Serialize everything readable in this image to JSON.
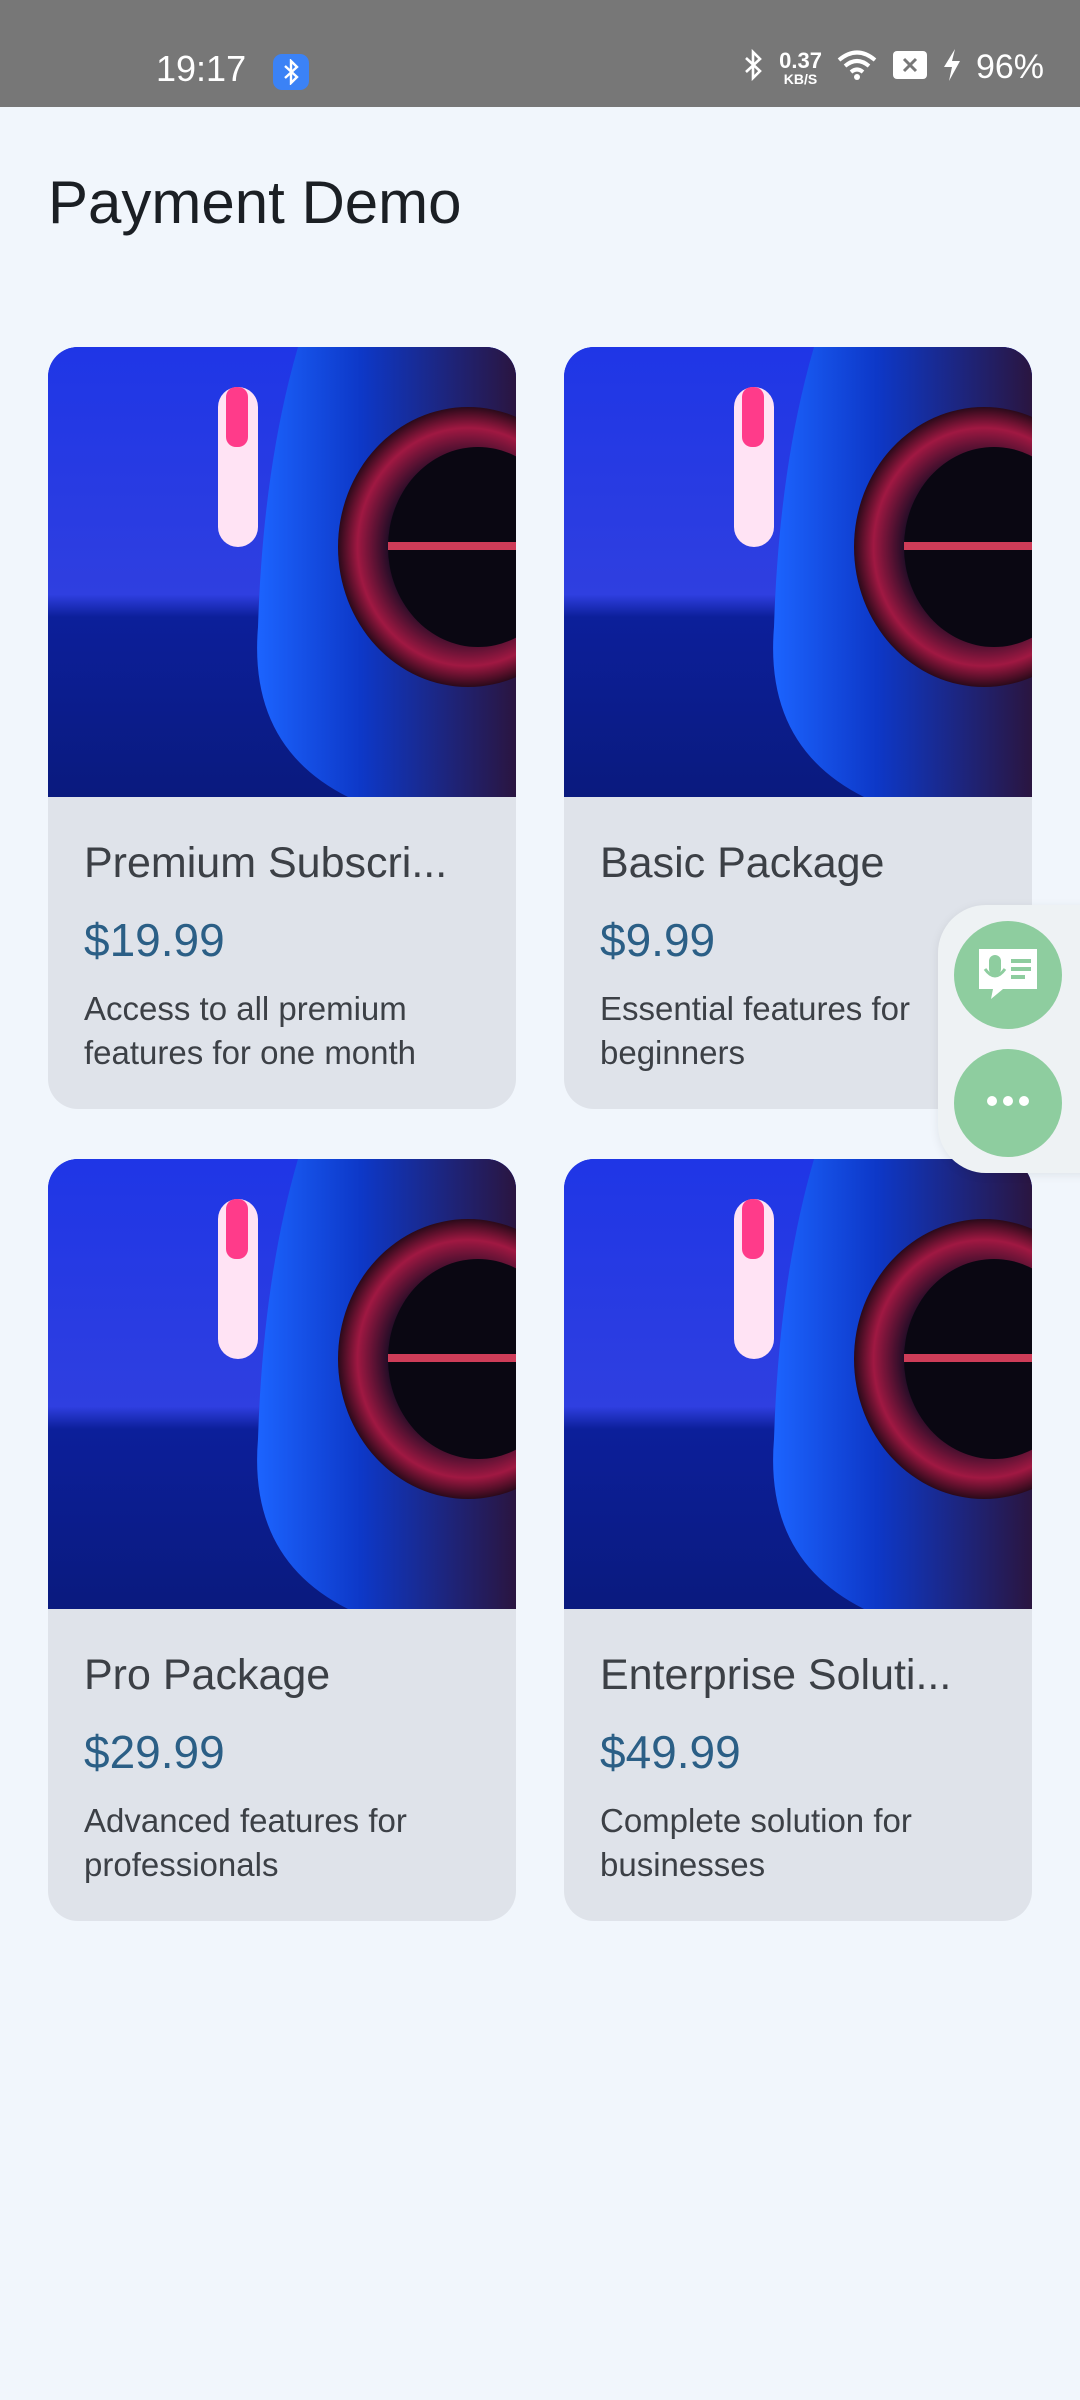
{
  "status_bar": {
    "time": "19:17",
    "speed_value": "0.37",
    "speed_unit": "KB/S",
    "battery": "96%",
    "icons": [
      "bluetooth-icon",
      "wifi-icon",
      "sim-off-icon",
      "charging-icon"
    ]
  },
  "page": {
    "title": "Payment Demo"
  },
  "products": [
    {
      "title": "Premium Subscri...",
      "price": "$19.99",
      "description": "Access to all premium features for one month"
    },
    {
      "title": "Basic Package",
      "price": "$9.99",
      "description": "Essential features for beginners"
    },
    {
      "title": "Pro Package",
      "price": "$29.99",
      "description": "Advanced features for professionals"
    },
    {
      "title": "Enterprise Soluti...",
      "price": "$49.99",
      "description": "Complete solution for businesses"
    }
  ],
  "floating_panel": {
    "icons": [
      "voice-input-icon",
      "more-icon"
    ]
  },
  "colors": {
    "background": "#f1f6fc",
    "card": "#dfe3ea",
    "price": "#2b5f86",
    "fab": "#8ecd9f"
  }
}
